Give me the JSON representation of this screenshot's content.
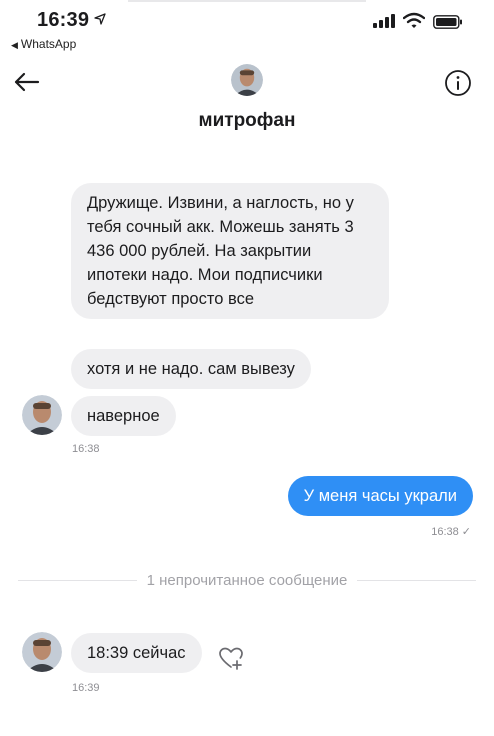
{
  "status_bar": {
    "time": "16:39",
    "back_app": "WhatsApp"
  },
  "header": {
    "contact_name": "митрофан"
  },
  "messages": [
    {
      "text": "Дружище. Извини, а наглость, но у тебя сочный акк. Можешь занять 3 436 000 рублей. На закрытии ипотеки надо. Мои подписчики бедствуют просто все"
    },
    {
      "text": "хотя и не надо. сам вывезу"
    },
    {
      "text": "наверное",
      "time": "16:38"
    },
    {
      "text": "У меня часы украли",
      "time": "16:38"
    },
    {
      "text": "18:39 сейчас",
      "time": "16:39"
    }
  ],
  "divider": {
    "text": "1 непрочитанное сообщение"
  },
  "colors": {
    "incoming_bubble": "#efeff1",
    "outgoing_bubble": "#2f8ff5",
    "timestamp": "#8e8e93"
  },
  "icons": [
    "location-arrow-icon",
    "signal-icon",
    "wifi-icon",
    "battery-icon",
    "back-arrow-icon",
    "info-icon",
    "heart-plus-icon"
  ]
}
